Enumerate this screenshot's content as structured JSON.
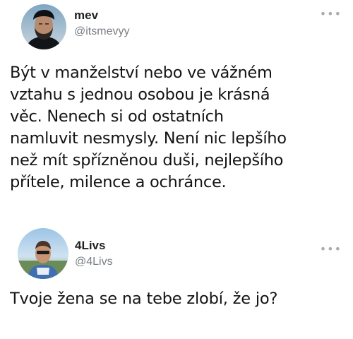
{
  "tweets": [
    {
      "display_name": "mev",
      "handle": "@itsmevyy",
      "more_icon": "more-horizontal-icon",
      "text": "Být v manželství nebo ve vážném\nvztahu s jednou osobou je krásná\nvěc. Nenech si od ostatních\nnamluvit nesmysly. Není nic lepšího\nnež mít spřízněnou duši, nejlepšího\npřítele, milence a ochránce."
    },
    {
      "display_name": "4Livs",
      "handle": "@4Livs",
      "more_icon": "more-horizontal-icon",
      "text": "Tvoje žena se na tebe zlobí, že jo?"
    }
  ],
  "colors": {
    "background": "#ffffff",
    "text": "#141414",
    "handle": "#7a7f85",
    "more_icon": "#a8adb3"
  }
}
